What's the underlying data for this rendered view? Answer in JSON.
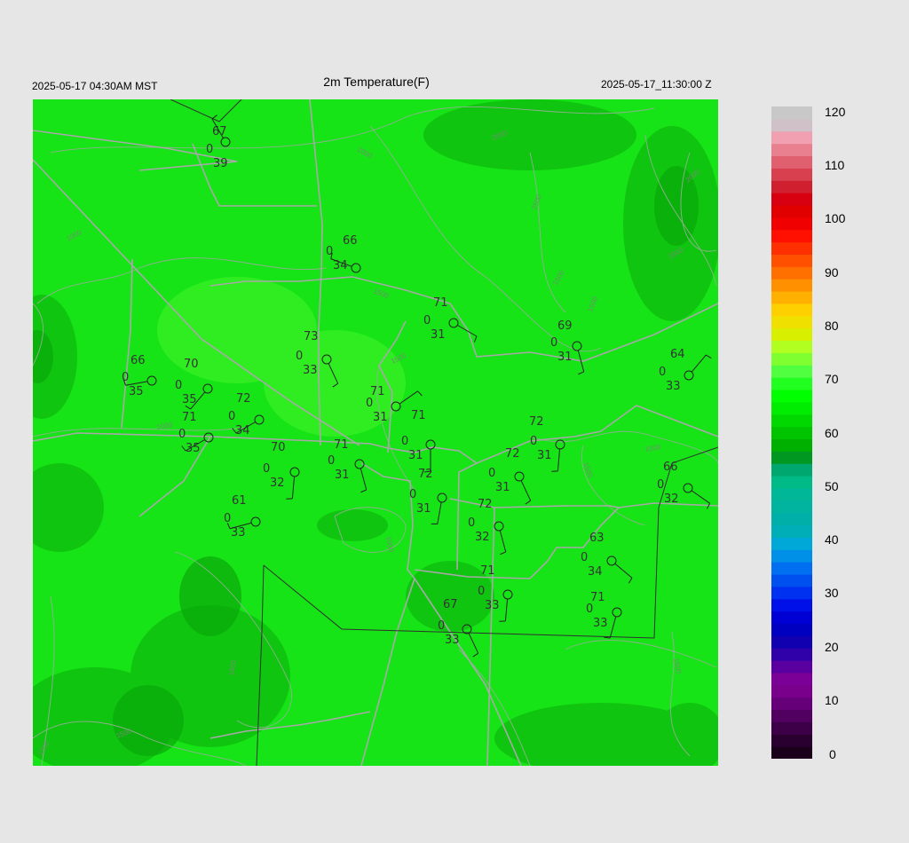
{
  "header": {
    "local_time": "2025-05-17 04:30AM MST",
    "title": "2m Temperature(F)",
    "utc_time": "2025-05-17_11:30:00 Z"
  },
  "colorbar": {
    "ticks": [
      "120",
      "110",
      "100",
      "90",
      "80",
      "70",
      "60",
      "50",
      "40",
      "30",
      "20",
      "10",
      "0"
    ],
    "min": 0,
    "max": 120
  },
  "contours": [
    "1000",
    "1000",
    "1500",
    "1500",
    "1500",
    "1500",
    "2000",
    "2000",
    "2500",
    "2000",
    "2500",
    "1500",
    "1000",
    "1000",
    "1500",
    "1500",
    "1500",
    "1500"
  ],
  "stations": [
    {
      "temp": "67",
      "wind": "0",
      "dew": "39"
    },
    {
      "temp": "66",
      "wind": "0",
      "dew": "34"
    },
    {
      "temp": "71",
      "wind": "0",
      "dew": "31"
    },
    {
      "temp": "69",
      "wind": "0",
      "dew": "31"
    },
    {
      "temp": "64",
      "wind": "0",
      "dew": "33"
    },
    {
      "temp": "66",
      "wind": "0",
      "dew": "35"
    },
    {
      "temp": "70",
      "wind": "0",
      "dew": "35"
    },
    {
      "temp": "73",
      "wind": "0",
      "dew": "33"
    },
    {
      "temp": "71",
      "wind": "0",
      "dew": "31"
    },
    {
      "temp": "72",
      "wind": "0",
      "dew": "34"
    },
    {
      "temp": "71",
      "wind": "0",
      "dew": "35"
    },
    {
      "temp": "71",
      "wind": "0",
      "dew": "31"
    },
    {
      "temp": "72",
      "wind": "0",
      "dew": "31"
    },
    {
      "temp": "70",
      "wind": "0",
      "dew": "32"
    },
    {
      "temp": "71",
      "wind": "0",
      "dew": "31"
    },
    {
      "temp": "72",
      "wind": "0",
      "dew": "31"
    },
    {
      "temp": "72",
      "wind": "0",
      "dew": "31"
    },
    {
      "temp": "66",
      "wind": "0",
      "dew": "32"
    },
    {
      "temp": "61",
      "wind": "0",
      "dew": "33"
    },
    {
      "temp": "72",
      "wind": "0",
      "dew": "32"
    },
    {
      "temp": "63",
      "wind": "0",
      "dew": "34"
    },
    {
      "temp": "71",
      "wind": "0",
      "dew": "33"
    },
    {
      "temp": "71",
      "wind": "0",
      "dew": "33"
    },
    {
      "temp": "67",
      "wind": "0",
      "dew": "33"
    }
  ]
}
